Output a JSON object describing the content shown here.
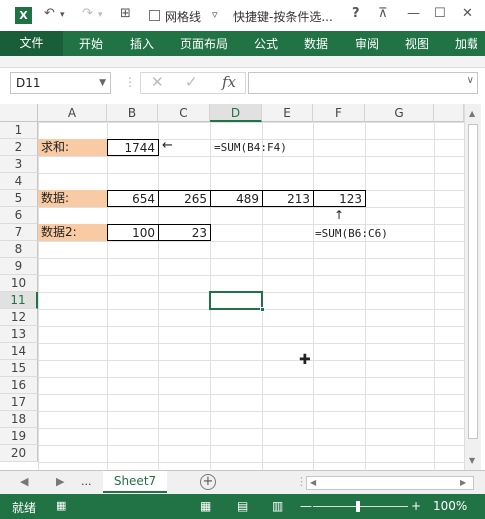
{
  "titlebar": {
    "logo": "X",
    "undo_icon": "↶",
    "redo_icon": "↷",
    "table_icon": "⊞",
    "gridlines_label": "网格线",
    "dropdown_icon": "▿",
    "title": "快捷键-按条件选...",
    "help": "?",
    "restore": "⊼",
    "minimize": "—",
    "maximize": "☐",
    "close": "✕"
  },
  "ribbon": {
    "tabs": [
      "文件",
      "开始",
      "插入",
      "页面布局",
      "公式",
      "数据",
      "审阅",
      "视图",
      "加载"
    ]
  },
  "formula_bar": {
    "name_box": "D11",
    "cancel": "✕",
    "enter": "✓",
    "fx": "fx",
    "formula": ""
  },
  "columns": [
    "A",
    "B",
    "C",
    "D",
    "E",
    "F",
    "G"
  ],
  "rows": [
    "1",
    "2",
    "3",
    "4",
    "5",
    "6",
    "7",
    "8",
    "9",
    "10",
    "11",
    "12",
    "13",
    "14",
    "15",
    "16",
    "17",
    "18",
    "19",
    "20"
  ],
  "cells": {
    "a2": "求和:",
    "b2": "1744",
    "arrow_left": "←",
    "formula_note_1": "=SUM(B4:F4)",
    "a5": "数据:",
    "b5": "654",
    "c5": "265",
    "d5": "489",
    "e5": "213",
    "f5": "123",
    "arrow_up": "↑",
    "a7": "数据2:",
    "b7": "100",
    "c7": "23",
    "formula_note_2": "=SUM(B6:C6)"
  },
  "cursor": "✚",
  "sheets": {
    "prev": "◀",
    "next": "▶",
    "more": "...",
    "active": "Sheet7",
    "add": "+"
  },
  "status": {
    "mode": "就绪",
    "zoom_minus": "—",
    "zoom_plus": "+",
    "zoom": "100%",
    "zoom_level": 1.0
  },
  "colors": {
    "accent": "#217346",
    "label_fill": "#f8cba4"
  }
}
